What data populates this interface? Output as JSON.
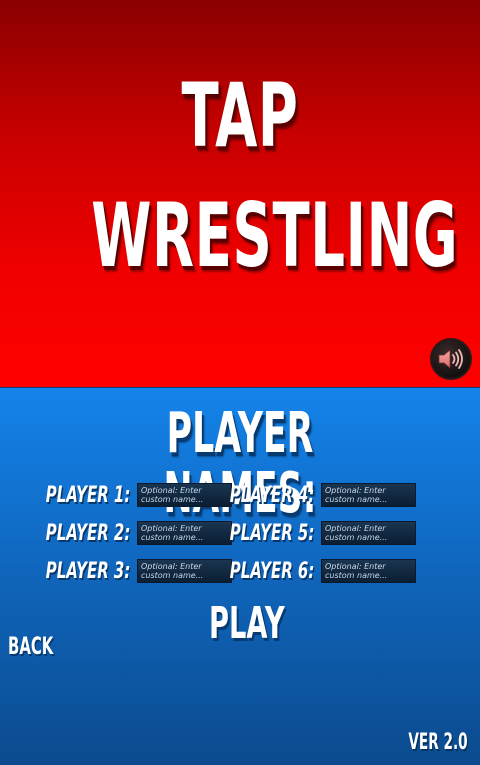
{
  "title": {
    "line1": "TAP",
    "line2": "WRESTLING"
  },
  "sound": {
    "icon": "speaker-volume-icon"
  },
  "player_names": {
    "heading": "PLAYER NAMES:",
    "placeholder": "Optional: Enter custom name...",
    "players": [
      {
        "label": "PLAYER 1:",
        "value": ""
      },
      {
        "label": "PLAYER 2:",
        "value": ""
      },
      {
        "label": "PLAYER 3:",
        "value": ""
      },
      {
        "label": "PLAYER 4:",
        "value": ""
      },
      {
        "label": "PLAYER 5:",
        "value": ""
      },
      {
        "label": "PLAYER 6:",
        "value": ""
      }
    ]
  },
  "actions": {
    "play_label": "PLAY",
    "back_label": "BACK"
  },
  "footer": {
    "version": "VER 2.0"
  },
  "colors": {
    "top_red": "#ff0000",
    "bottom_blue": "#1483ea",
    "text": "#ffffff"
  }
}
